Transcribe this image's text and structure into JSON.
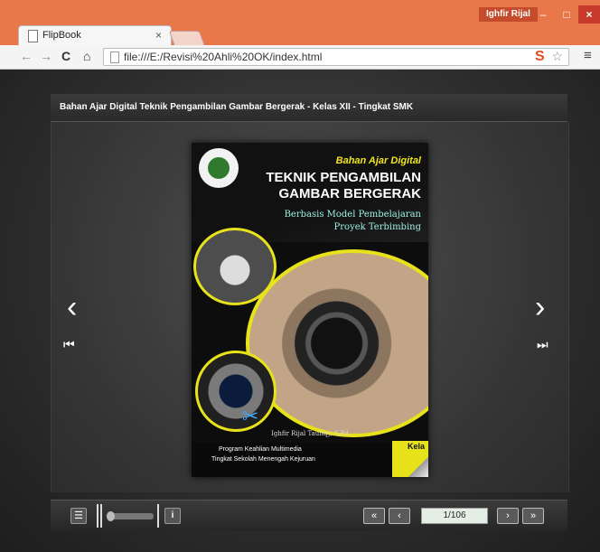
{
  "window": {
    "user": "Ighfir Rijal",
    "minimize": "–",
    "maximize": "□",
    "close": "×"
  },
  "tab": {
    "title": "FlipBook",
    "close": "×"
  },
  "toolbar": {
    "back": "←",
    "forward": "→",
    "reload": "C",
    "home": "⌂",
    "url": "file:///E:/Revisi%20Ahli%20OK/index.html",
    "star": "☆",
    "extension": "S",
    "menu": "≡"
  },
  "book": {
    "title": "Bahan Ajar Digital Teknik Pengambilan Gambar Bergerak - Kelas XII - Tingkat SMK",
    "nav_prev": "‹",
    "nav_next": "›",
    "jump_first": "⏮",
    "jump_last": "⏭"
  },
  "cover": {
    "kicker": "Bahan Ajar Digital",
    "title_line1": "TEKNIK PENGAMBILAN",
    "title_line2": "GAMBAR BERGERAK",
    "subtitle_line1": "Berbasis Model Pembelajaran",
    "subtitle_line2": "Proyek Terbimbing",
    "author": "Ighfir Rijal Taufiqy, S.Pd",
    "footer_line1": "Program Keahlian Multimedia",
    "footer_line2": "Tingkat Sekolah Menengah Kejuruan",
    "kelas": "Kela"
  },
  "controls": {
    "toc": "☰",
    "info": "i",
    "first": "«",
    "prev": "‹",
    "page_indicator": "1/106",
    "next": "›",
    "last": "»",
    "zoom_level": 0
  }
}
